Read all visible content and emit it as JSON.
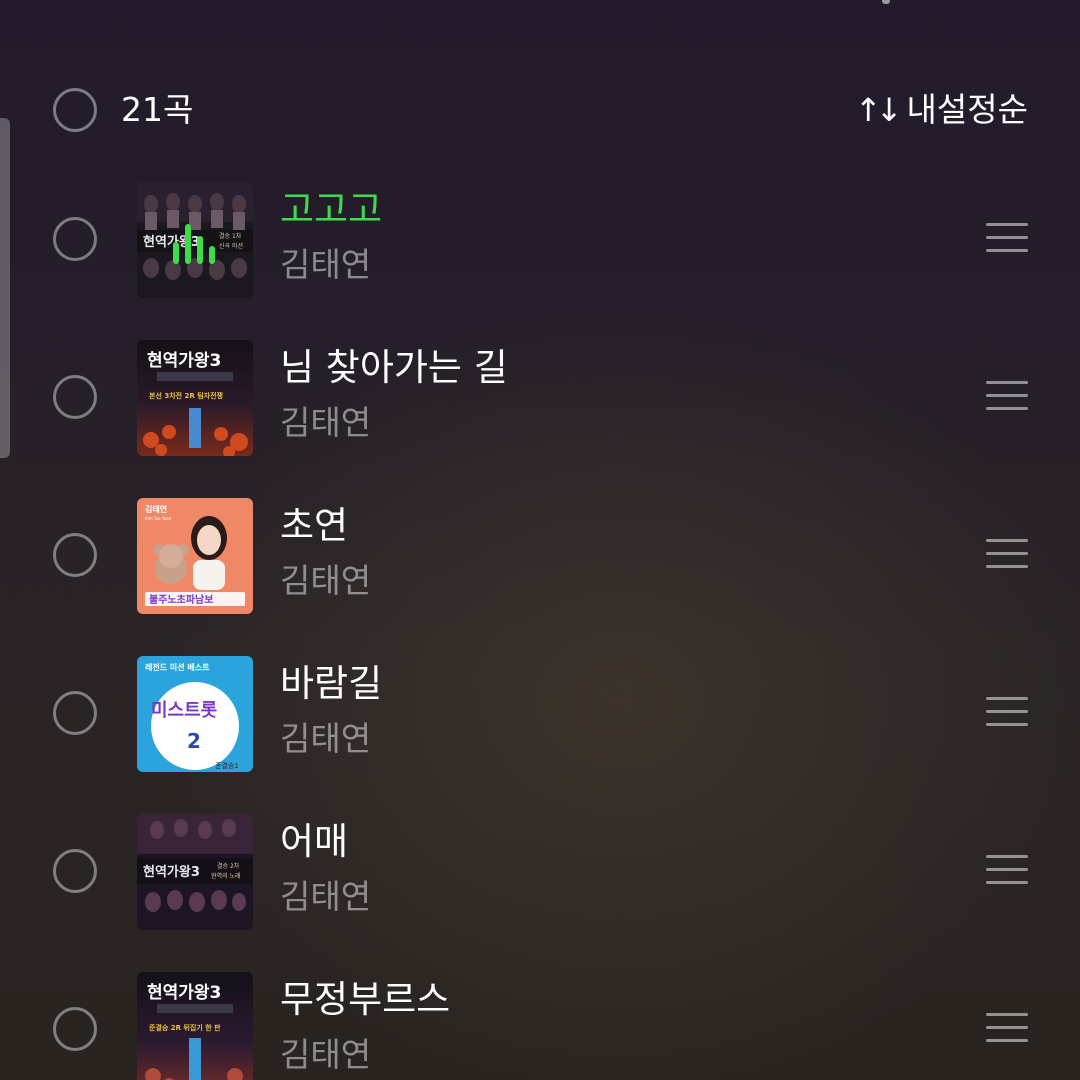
{
  "header": {
    "count": "21곡",
    "sort_icon": "↑↓",
    "sort_label": "내설정순"
  },
  "colors": {
    "playing_title": "#3ddc4b",
    "text": "#ffffff",
    "secondary_text": "rgba(255,255,255,0.48)"
  },
  "playlist": [
    {
      "title": "고고고",
      "artist": "김태연",
      "playing": true
    },
    {
      "title": "님 찾아가는 길",
      "artist": "김태연",
      "playing": false
    },
    {
      "title": "초연",
      "artist": "김태연",
      "playing": false
    },
    {
      "title": "바람길",
      "artist": "김태연",
      "playing": false
    },
    {
      "title": "어매",
      "artist": "김태연",
      "playing": false
    },
    {
      "title": "무정부르스",
      "artist": "김태연",
      "playing": false
    }
  ],
  "album_art": {
    "a1": {
      "title": "현역가왕3",
      "caption1": "결승 1차",
      "caption2": "신곡 미션"
    },
    "a2": {
      "title": "현역가왕3",
      "caption1": "본선 3차전 2R 팀자전쟁"
    },
    "a3": {
      "name": "김태연",
      "subtitle": "Kim Tae Yeon",
      "caption": "불주노초파남보"
    },
    "a4": {
      "top": "레전드 미션 베스트",
      "title": "미스트롯",
      "number": "2",
      "caption": "준결승1"
    },
    "a5": {
      "title": "현역가왕3",
      "caption1": "결승 2차",
      "caption2": "현역의 노래"
    },
    "a6": {
      "title": "현역가왕3",
      "caption1": "준결승 2R 뒤집기 한 판"
    }
  }
}
